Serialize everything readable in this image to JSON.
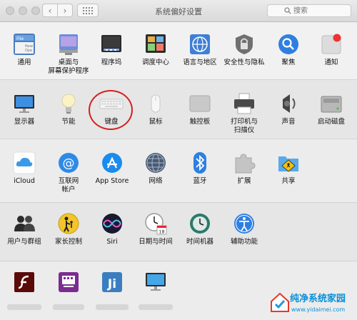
{
  "window": {
    "title": "系统偏好设置"
  },
  "search": {
    "placeholder": "搜索"
  },
  "row1": [
    {
      "label": "通用",
      "icon": "general-icon"
    },
    {
      "label": "桌面与",
      "label2": "屏幕保护程序",
      "icon": "desktop-icon"
    },
    {
      "label": "程序坞",
      "icon": "dock-icon"
    },
    {
      "label": "调度中心",
      "icon": "mission-control-icon"
    },
    {
      "label": "语言与地区",
      "icon": "language-icon"
    },
    {
      "label": "安全性与隐私",
      "icon": "security-icon"
    },
    {
      "label": "聚焦",
      "icon": "spotlight-icon"
    },
    {
      "label": "通知",
      "icon": "notifications-icon"
    }
  ],
  "row2": [
    {
      "label": "显示器",
      "icon": "display-icon"
    },
    {
      "label": "节能",
      "icon": "energy-icon"
    },
    {
      "label": "键盘",
      "icon": "keyboard-icon"
    },
    {
      "label": "鼠标",
      "icon": "mouse-icon"
    },
    {
      "label": "触控板",
      "icon": "trackpad-icon"
    },
    {
      "label": "打印机与",
      "label2": "扫描仪",
      "icon": "printer-icon"
    },
    {
      "label": "声音",
      "icon": "sound-icon"
    },
    {
      "label": "启动磁盘",
      "icon": "startup-disk-icon"
    }
  ],
  "row3": [
    {
      "label": "iCloud",
      "icon": "icloud-icon"
    },
    {
      "label": "互联网",
      "label2": "帐户",
      "icon": "internet-accounts-icon"
    },
    {
      "label": "App Store",
      "icon": "app-store-icon"
    },
    {
      "label": "网络",
      "icon": "network-icon"
    },
    {
      "label": "蓝牙",
      "icon": "bluetooth-icon"
    },
    {
      "label": "扩展",
      "icon": "extensions-icon"
    },
    {
      "label": "共享",
      "icon": "sharing-icon"
    }
  ],
  "row4": [
    {
      "label": "用户与群组",
      "icon": "users-icon"
    },
    {
      "label": "家长控制",
      "icon": "parental-controls-icon"
    },
    {
      "label": "Siri",
      "icon": "siri-icon"
    },
    {
      "label": "日期与时间",
      "icon": "date-time-icon"
    },
    {
      "label": "时间机器",
      "icon": "time-machine-icon"
    },
    {
      "label": "辅助功能",
      "icon": "accessibility-icon"
    }
  ],
  "row5": [
    {
      "icon": "flash-player-icon"
    },
    {
      "icon": "third-party-pane-icon"
    },
    {
      "icon": "java-icon"
    },
    {
      "icon": "monitor-pane-icon"
    }
  ],
  "watermark": {
    "text": "纯净系统家园",
    "url": "www.yidaimei.com"
  },
  "calendar_day": "18"
}
